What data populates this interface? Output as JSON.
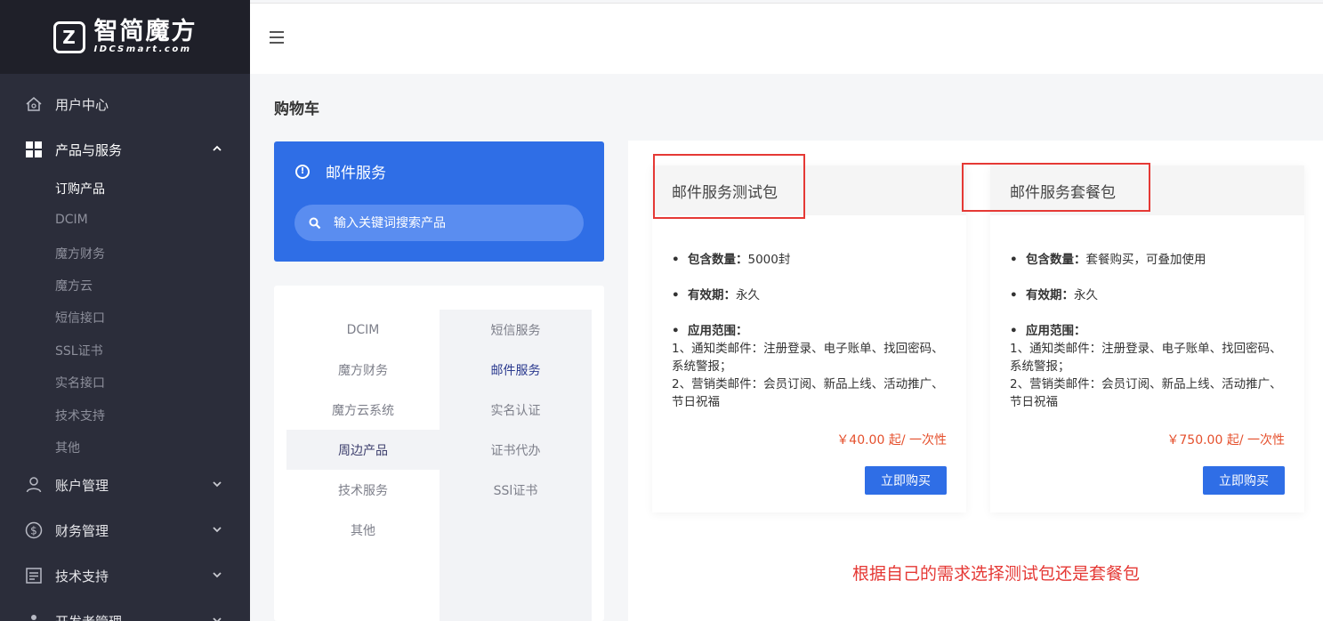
{
  "logo": {
    "cn": "智简魔方",
    "en": "IDCSmart.com",
    "mark": "Z"
  },
  "sidebar": {
    "user_center": "用户中心",
    "products_services": "产品与服务",
    "sub_items": [
      "订购产品",
      "DCIM",
      "魔方财务",
      "魔方云",
      "短信接口",
      "SSL证书",
      "实名接口",
      "技术支持",
      "其他"
    ],
    "account_mgmt": "账户管理",
    "finance_mgmt": "财务管理",
    "tech_support": "技术支持",
    "developer_mgmt": "开发者管理"
  },
  "page": {
    "title": "购物车"
  },
  "service_card": {
    "title": "邮件服务",
    "search_placeholder": "输入关键词搜索产品"
  },
  "categories": {
    "left": [
      "DCIM",
      "魔方财务",
      "魔方云系统",
      "周边产品",
      "技术服务",
      "其他"
    ],
    "right": [
      "短信服务",
      "邮件服务",
      "实名认证",
      "证书代办",
      "SSl证书"
    ]
  },
  "products": [
    {
      "name": "邮件服务测试包",
      "qty_label": "包含数量：",
      "qty_value": "5000封",
      "validity_label": "有效期：",
      "validity_value": "永久",
      "scope_label": "应用范围：",
      "scope_line1": "1、通知类邮件：注册登录、电子账单、找回密码、系统警报；",
      "scope_line2": "2、营销类邮件：会员订阅、新品上线、活动推广、节日祝福",
      "price": "￥40.00 起/ 一次性",
      "buy": "立即购买"
    },
    {
      "name": "邮件服务套餐包",
      "qty_label": "包含数量：",
      "qty_value": "套餐购买，可叠加使用",
      "validity_label": "有效期：",
      "validity_value": "永久",
      "scope_label": "应用范围：",
      "scope_line1": "1、通知类邮件：注册登录、电子账单、找回密码、系统警报；",
      "scope_line2": "2、营销类邮件：会员订阅、新品上线、活动推广、节日祝福",
      "price": "￥750.00 起/ 一次性",
      "buy": "立即购买"
    }
  ],
  "annotation": "根据自己的需求选择测试包还是套餐包",
  "colors": {
    "sidebar_bg": "#2b2d3a",
    "primary": "#2f6ee6",
    "price": "#e5502d",
    "annotation": "#e53935"
  },
  "icons": [
    "home-icon",
    "grid-icon",
    "user-icon",
    "dollar-icon",
    "document-icon",
    "developer-icon",
    "search-icon",
    "info-icon",
    "hamburger-icon",
    "chevron-up-icon",
    "chevron-down-icon"
  ]
}
